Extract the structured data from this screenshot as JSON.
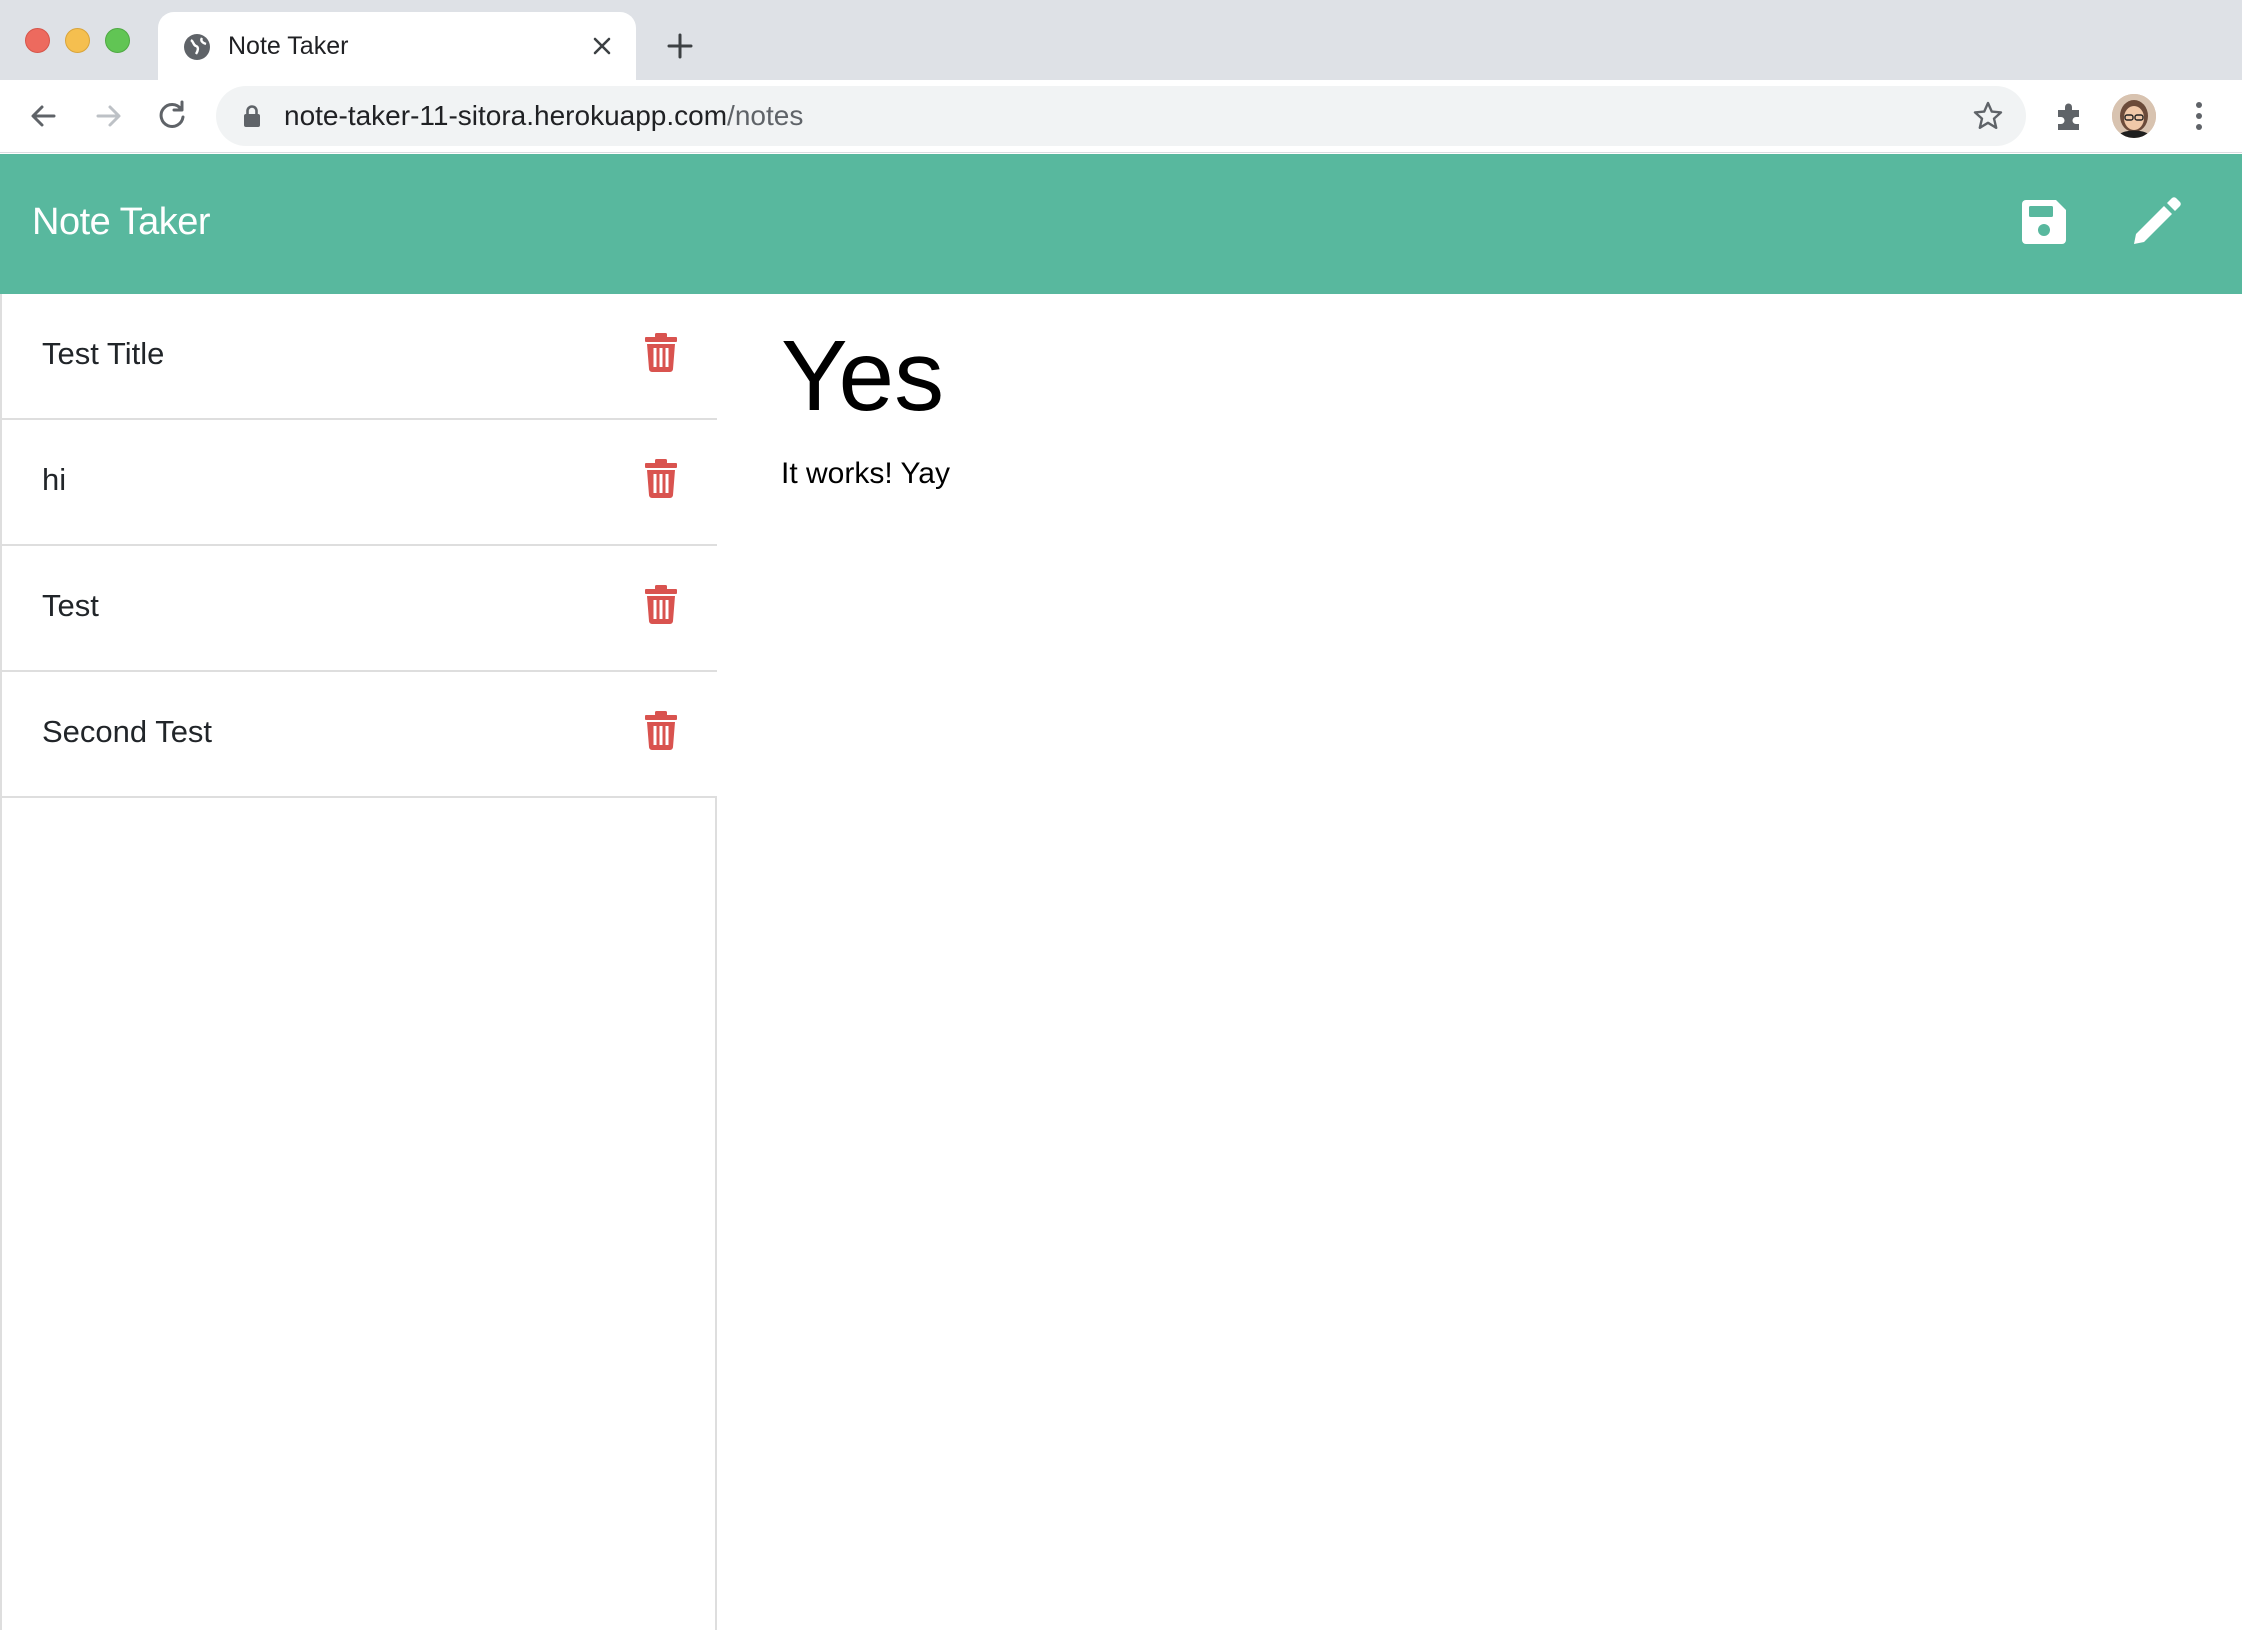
{
  "browser": {
    "tab_title": "Note Taker",
    "url_host": "note-taker-11-sitora.herokuapp.com",
    "url_path": "/notes"
  },
  "app": {
    "brand": "Note Taker",
    "accent_color": "#58b89e",
    "delete_color": "#d9534f"
  },
  "notes": [
    {
      "title": "Test Title"
    },
    {
      "title": "hi"
    },
    {
      "title": "Test"
    },
    {
      "title": "Second Test"
    }
  ],
  "active_note": {
    "title": "Yes",
    "text": "It works! Yay"
  }
}
